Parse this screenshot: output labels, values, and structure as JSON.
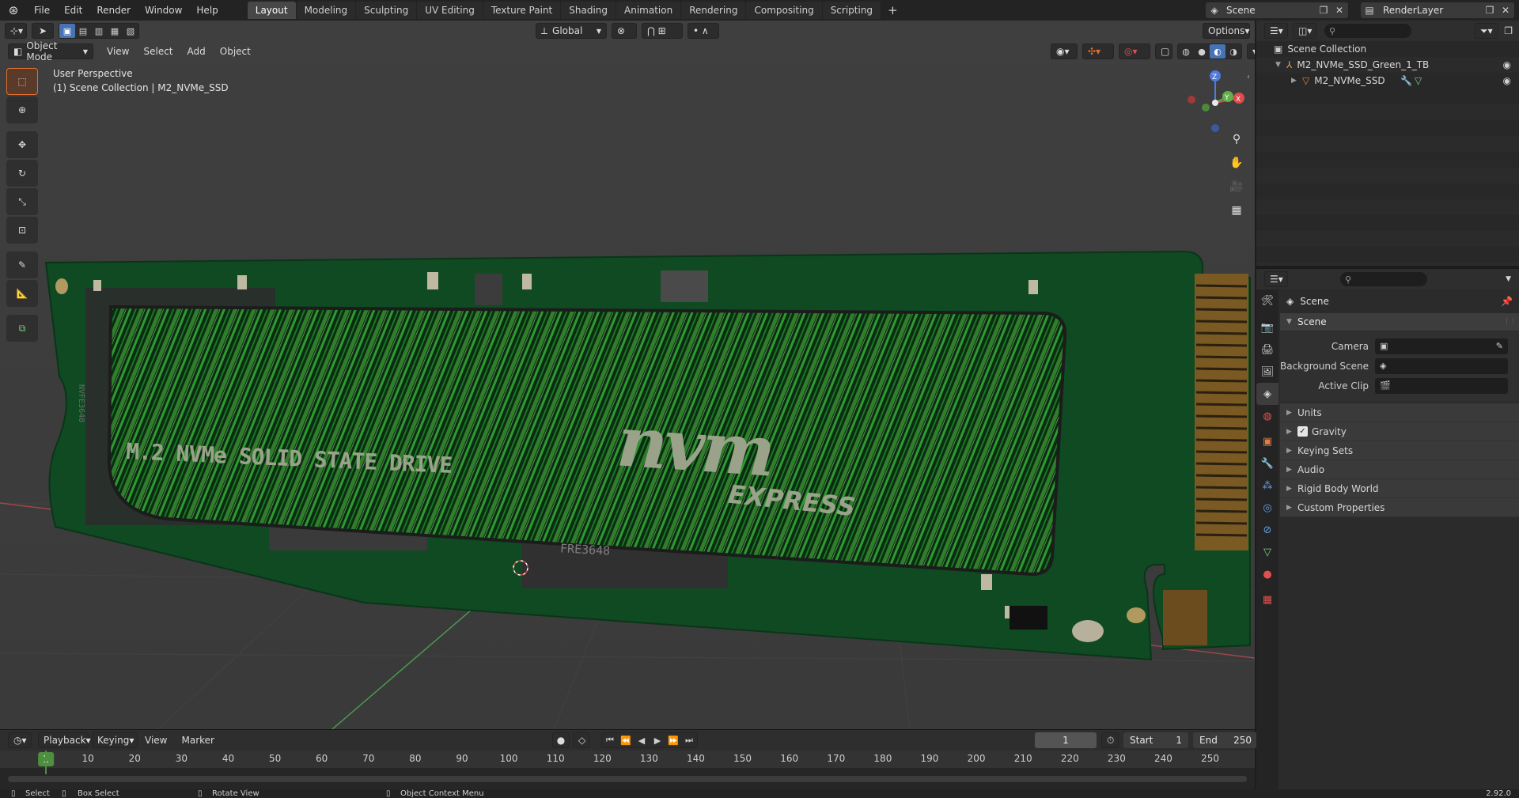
{
  "topbar": {
    "menus": [
      "File",
      "Edit",
      "Render",
      "Window",
      "Help"
    ],
    "workspaces": [
      "Layout",
      "Modeling",
      "Sculpting",
      "UV Editing",
      "Texture Paint",
      "Shading",
      "Animation",
      "Rendering",
      "Compositing",
      "Scripting"
    ],
    "active_workspace": "Layout",
    "scene_name": "Scene",
    "view_layer": "RenderLayer"
  },
  "viewport": {
    "mode": "Object Mode",
    "menus": [
      "View",
      "Select",
      "Add",
      "Object"
    ],
    "orientation": "Global",
    "options_label": "Options",
    "perspective": "User Perspective",
    "collection_info": "(1) Scene Collection | M2_NVMe_SSD",
    "ssd_title": "M.2 NVMe SOLID STATE DRIVE",
    "logo_main": "nvm",
    "logo_sub": "EXPRESS",
    "chip_label": "FRE3648",
    "side_label": "NVFE3648",
    "gizmo": {
      "x": "X",
      "y": "Y",
      "z": "Z"
    }
  },
  "timeline": {
    "menus": [
      "Playback",
      "Keying",
      "View",
      "Marker"
    ],
    "current_frame": "1",
    "start_label": "Start",
    "start_value": "1",
    "end_label": "End",
    "end_value": "250",
    "ticks": [
      "10",
      "20",
      "30",
      "40",
      "50",
      "60",
      "70",
      "80",
      "90",
      "100",
      "110",
      "120",
      "130",
      "140",
      "150",
      "160",
      "170",
      "180",
      "190",
      "200",
      "210",
      "220",
      "230",
      "240",
      "250"
    ],
    "cursor_frame": "1"
  },
  "statusbar": {
    "select": "Select",
    "box_select": "Box Select",
    "rotate_view": "Rotate View",
    "context_menu": "Object Context Menu",
    "version": "2.92.0"
  },
  "outliner": {
    "root": "Scene Collection",
    "items": [
      {
        "label": "M2_NVMe_SSD_Green_1_TB"
      },
      {
        "label": "M2_NVMe_SSD"
      }
    ]
  },
  "properties": {
    "context": "Scene",
    "panel_title": "Scene",
    "camera_label": "Camera",
    "background_label": "Background Scene",
    "active_clip_label": "Active Clip",
    "subpanels": [
      "Units",
      "Gravity",
      "Keying Sets",
      "Audio",
      "Rigid Body World",
      "Custom Properties"
    ],
    "gravity_checked": true
  },
  "colors": {
    "accent_orange": "#e07030",
    "active_blue": "#4772b3",
    "frame_green": "#4d8f3f",
    "pcb_green": "#0f4a22"
  }
}
